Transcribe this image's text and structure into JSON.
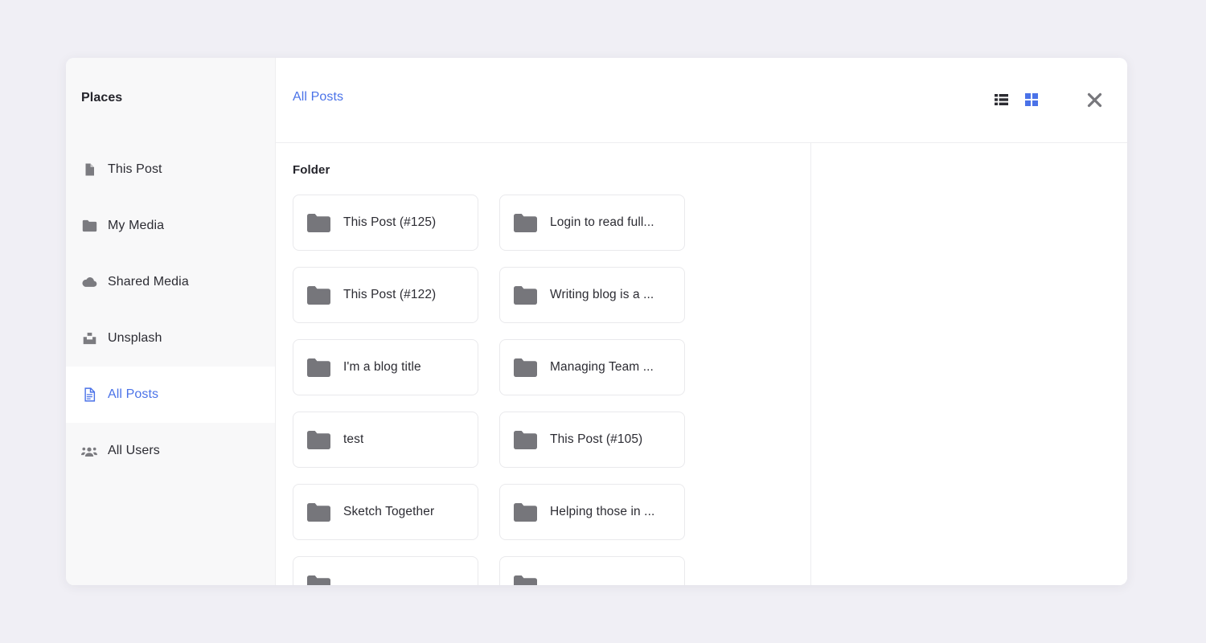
{
  "sidebar": {
    "title": "Places",
    "items": [
      {
        "label": "This Post",
        "icon": "file-icon",
        "active": false
      },
      {
        "label": "My Media",
        "icon": "folder-icon",
        "active": false
      },
      {
        "label": "Shared Media",
        "icon": "cloud-icon",
        "active": false
      },
      {
        "label": "Unsplash",
        "icon": "unsplash-icon",
        "active": false
      },
      {
        "label": "All Posts",
        "icon": "document-icon",
        "active": true
      },
      {
        "label": "All Users",
        "icon": "users-icon",
        "active": false
      }
    ]
  },
  "topbar": {
    "breadcrumb": "All Posts",
    "list_view_icon": "list-view-icon",
    "grid_view_icon": "grid-view-icon",
    "close_icon": "close-icon",
    "active_view": "grid"
  },
  "main": {
    "section_title": "Folder",
    "folders": [
      {
        "name": "This Post (#125)",
        "icon": "folder-icon"
      },
      {
        "name": "Login to read full...",
        "icon": "folder-icon"
      },
      {
        "name": "This Post (#122)",
        "icon": "folder-icon"
      },
      {
        "name": "Writing blog is a ...",
        "icon": "folder-icon"
      },
      {
        "name": "I'm a blog title",
        "icon": "folder-icon"
      },
      {
        "name": "Managing Team ...",
        "icon": "folder-icon"
      },
      {
        "name": "test",
        "icon": "folder-icon"
      },
      {
        "name": "This Post (#105)",
        "icon": "folder-icon"
      },
      {
        "name": "Sketch Together",
        "icon": "folder-icon"
      },
      {
        "name": "Helping those in ...",
        "icon": "folder-icon"
      },
      {
        "name": "",
        "icon": "folder-icon"
      },
      {
        "name": "",
        "icon": "folder-icon"
      }
    ]
  },
  "colors": {
    "accent": "#4a72e8",
    "icon_gray": "#7b7b80",
    "text": "#2c2c33",
    "page_bg": "#f0eff5"
  }
}
